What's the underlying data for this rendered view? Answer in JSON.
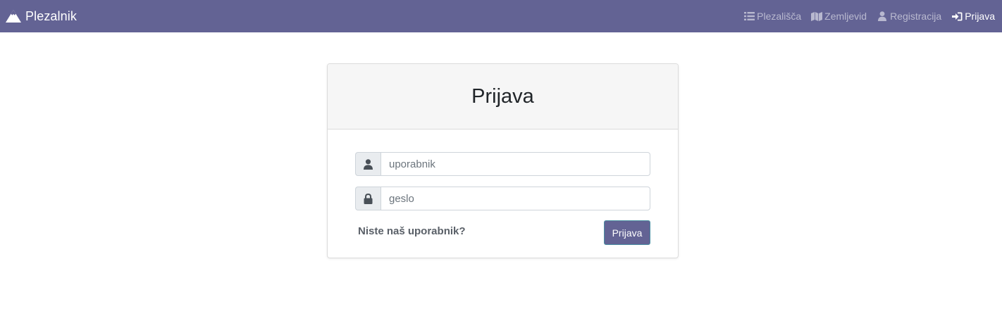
{
  "navbar": {
    "brand": "Plezalnik",
    "links": [
      {
        "label": "Plezališča",
        "icon": "list-icon"
      },
      {
        "label": "Zemljevid",
        "icon": "map-icon"
      },
      {
        "label": "Registracija",
        "icon": "user-icon"
      },
      {
        "label": "Prijava",
        "icon": "sign-in-icon",
        "active": true
      }
    ],
    "colors": {
      "background": "#636394"
    }
  },
  "login": {
    "title": "Prijava",
    "username": {
      "placeholder": "uporabnik",
      "value": "",
      "icon": "user-icon"
    },
    "password": {
      "placeholder": "geslo",
      "value": "",
      "icon": "lock-icon"
    },
    "register_link": "Niste naš uporabnik?",
    "submit_label": "Prijava"
  }
}
